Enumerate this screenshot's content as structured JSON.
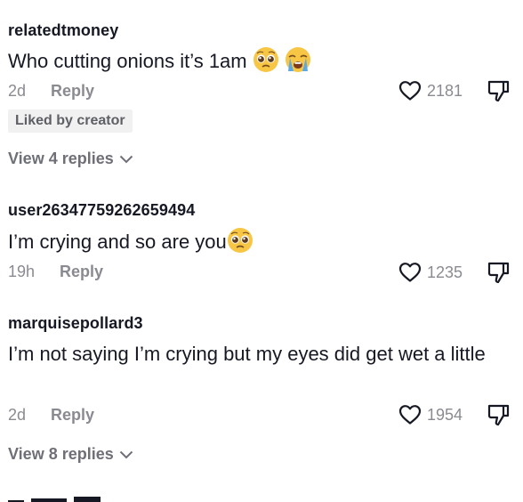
{
  "comments": [
    {
      "username": "relatedtmoney",
      "text": "Who cutting onions it’s 1am",
      "emojis": [
        "pleading-face",
        "loudly-crying-face"
      ],
      "time": "2d",
      "reply_label": "Reply",
      "likes": "2181",
      "badge": "Liked by creator",
      "view_replies": "View 4 replies"
    },
    {
      "username": "user26347759262659494",
      "text": "I’m crying and so are you",
      "emojis": [
        "pleading-face"
      ],
      "time": "19h",
      "reply_label": "Reply",
      "likes": "1235"
    },
    {
      "username": "marquisepollard3",
      "text": "I’m not saying I’m crying but my eyes did get wet a little",
      "time": "2d",
      "reply_label": "Reply",
      "likes": "1954",
      "view_replies": "View 8 replies"
    }
  ],
  "icons": {
    "like": "heart-outline-icon",
    "dislike": "thumbs-down-icon",
    "expand": "chevron-down-icon"
  },
  "colors": {
    "primary_text": "#161823",
    "secondary_text": "#8a8b91",
    "badge_bg": "#f1f1f2",
    "emoji_yellow": "#f7c644"
  }
}
